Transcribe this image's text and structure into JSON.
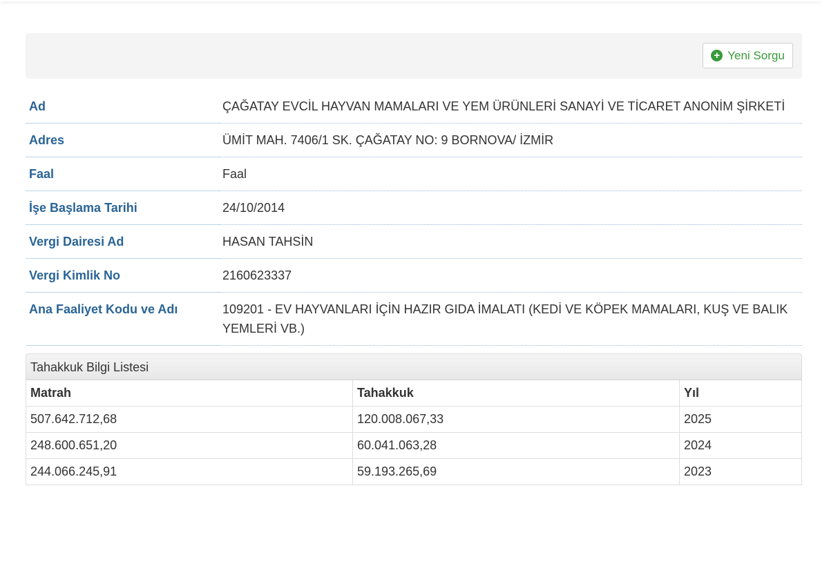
{
  "toolbar": {
    "new_query_label": "Yeni Sorgu",
    "new_query_icon": "plus-circle-icon",
    "accent_color": "#3a9a3a"
  },
  "details": [
    {
      "label": "Ad",
      "value": "ÇAĞATAY EVCİL HAYVAN MAMALARI VE YEM ÜRÜNLERİ SANAYİ VE TİCARET ANONİM ŞİRKETİ"
    },
    {
      "label": "Adres",
      "value": "ÜMİT MAH. 7406/1 SK. ÇAĞATAY NO: 9 BORNOVA/ İZMİR"
    },
    {
      "label": "Faal",
      "value": "Faal"
    },
    {
      "label": "İşe Başlama Tarihi",
      "value": "24/10/2014"
    },
    {
      "label": "Vergi Dairesi Ad",
      "value": "HASAN TAHSİN"
    },
    {
      "label": "Vergi Kimlik No",
      "value": "2160623337"
    },
    {
      "label": "Ana Faaliyet Kodu ve Adı",
      "value": "109201 - EV HAYVANLARI İÇİN HAZIR GIDA İMALATI (KEDİ VE KÖPEK MAMALARI, KUŞ VE BALIK YEMLERİ VB.)"
    }
  ],
  "tahakkuk": {
    "title": "Tahakkuk Bilgi Listesi",
    "columns": [
      "Matrah",
      "Tahakkuk",
      "Yıl"
    ],
    "rows": [
      [
        "507.642.712,68",
        "120.008.067,33",
        "2025"
      ],
      [
        "248.600.651,20",
        "60.041.063,28",
        "2024"
      ],
      [
        "244.066.245,91",
        "59.193.265,69",
        "2023"
      ]
    ]
  }
}
